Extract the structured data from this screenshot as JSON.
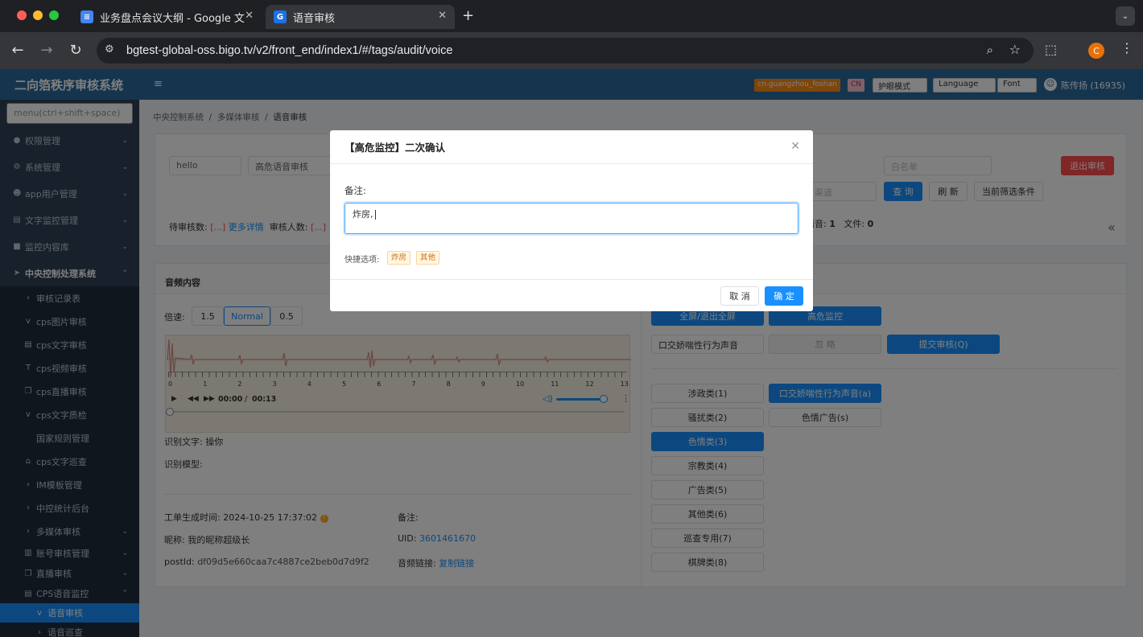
{
  "browser": {
    "tabs": [
      {
        "title": "业务盘点会议大纲 - Google 文",
        "icon": "google-docs-icon"
      },
      {
        "title": "语音审核",
        "icon": "g-favicon"
      }
    ],
    "url": "bgtest-global-oss.bigo.tv/v2/front_end/index1/#/tags/audit/voice",
    "profile_initial": "C"
  },
  "app": {
    "title": "二向箔秩序审核系统",
    "menu_placeholder": "menu(ctrl+shift+space)",
    "header": {
      "region": "cn-guangzhou_foshan",
      "lang_badge": "CN",
      "eye_mode": "护眼模式",
      "language": "Language",
      "font": "Font",
      "user": "陈传扬 (16935)"
    },
    "sidebar": [
      {
        "label": "权限管理"
      },
      {
        "label": "系统管理"
      },
      {
        "label": "app用户管理"
      },
      {
        "label": "文字监控管理"
      },
      {
        "label": "监控内容库"
      },
      {
        "label": "中央控制处理系统"
      },
      {
        "label": "审核记录表"
      },
      {
        "label": "cps图片审核"
      },
      {
        "label": "cps文字审核"
      },
      {
        "label": "cps视频审核"
      },
      {
        "label": "cps直播审核"
      },
      {
        "label": "cps文字质检"
      },
      {
        "label": "国家规则管理"
      },
      {
        "label": "cps文字巡查"
      },
      {
        "label": "IM模板管理"
      },
      {
        "label": "中控统计后台"
      },
      {
        "label": "多媒体审核"
      },
      {
        "label": "账号审核管理"
      },
      {
        "label": "直播审核"
      },
      {
        "label": "CPS语音监控"
      },
      {
        "label": "语音审核"
      },
      {
        "label": "语音巡查"
      }
    ],
    "breadcrumb": [
      "中央控制系统",
      "多媒体审核",
      "语音审核"
    ],
    "filters": {
      "sel1": "hello",
      "sel2": "高危语音审核",
      "whitelist_placeholder": "白名单",
      "channel_placeholder": "渠道",
      "query": "查 询",
      "refresh": "刷 新",
      "current_filter": "当前筛选条件",
      "exit": "退出审核",
      "pending_label": "待审核数:",
      "pending_val": "[...]",
      "more": "更多详情",
      "reviewers_label": "审核人数:",
      "reviewers_val": "[...]",
      "voice_label": "语音:",
      "voice_val": "1",
      "file_label": "文件:",
      "file_val": "0"
    },
    "audio_panel": {
      "title": "音频内容",
      "speed_label": "倍速:",
      "speeds": [
        "1.5",
        "Normal",
        "0.5"
      ],
      "ticks": [
        "0",
        "1",
        "2",
        "3",
        "4",
        "5",
        "6",
        "7",
        "8",
        "9",
        "10",
        "11",
        "12",
        "13"
      ],
      "time": "00:00",
      "duration": "00:13",
      "recognized_label": "识别文字:",
      "recognized_text": "操你",
      "model_label": "识别模型:",
      "created_label": "工单生成时间:",
      "created_val": "2024-10-25 17:37:02",
      "remark_label": "备注:",
      "nickname_label": "昵称:",
      "nickname_val": "我的昵称超级长",
      "uid_label": "UID:",
      "uid_val": "3601461670",
      "postid_label": "postId:",
      "postid_val": "df09d5e660caa7c4887ce2beb0d7d9f2",
      "audio_link_label": "音频链接:",
      "audio_link_val": "复制链接"
    },
    "actions": {
      "fullscreen": "全屏/退出全屏",
      "high_risk": "高危监控",
      "reason_select": "口交娇喘性行为声音",
      "ignore": "忽 略",
      "submit": "提交审核(Q)",
      "categories": [
        {
          "label": "涉政类(1)",
          "active": false
        },
        {
          "label": "口交娇喘性行为声音(a)",
          "active": true
        },
        {
          "label": "骚扰类(2)",
          "active": false
        },
        {
          "label": "色情广告(s)",
          "active": false
        },
        {
          "label": "色情类(3)",
          "active": true
        },
        {
          "label": "宗教类(4)",
          "active": false
        },
        {
          "label": "广告类(5)",
          "active": false
        },
        {
          "label": "其他类(6)",
          "active": false
        },
        {
          "label": "巡查专用(7)",
          "active": false
        },
        {
          "label": "棋牌类(8)",
          "active": false
        }
      ]
    }
  },
  "modal": {
    "title": "【高危监控】二次确认",
    "remark_label": "备注:",
    "remark_value": "炸房,",
    "quick_label": "快捷选项:",
    "quick_options": [
      "炸房",
      "其他"
    ],
    "cancel": "取 消",
    "confirm": "确 定"
  },
  "colors": {
    "primary": "#1890ff",
    "danger": "#ff4d4f",
    "sidebar": "#304156",
    "header": "#2b6b9e"
  }
}
